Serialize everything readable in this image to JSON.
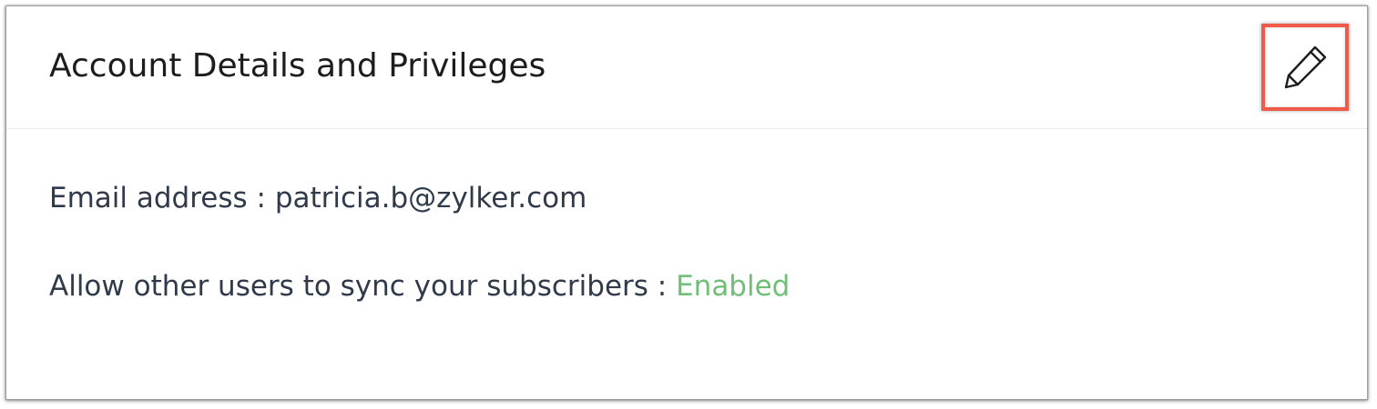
{
  "card": {
    "title": "Account Details and Privileges",
    "edit_icon": "pencil-icon"
  },
  "details": {
    "email": {
      "label": "Email address",
      "separator": " : ",
      "value": "patricia.b@zylker.com"
    },
    "sync": {
      "label": "Allow other users to sync your subscribers",
      "separator": " : ",
      "value": "Enabled",
      "value_color": "#6fbf77"
    }
  },
  "colors": {
    "highlight_border": "#ef5a49",
    "text": "#2f3a4a"
  }
}
